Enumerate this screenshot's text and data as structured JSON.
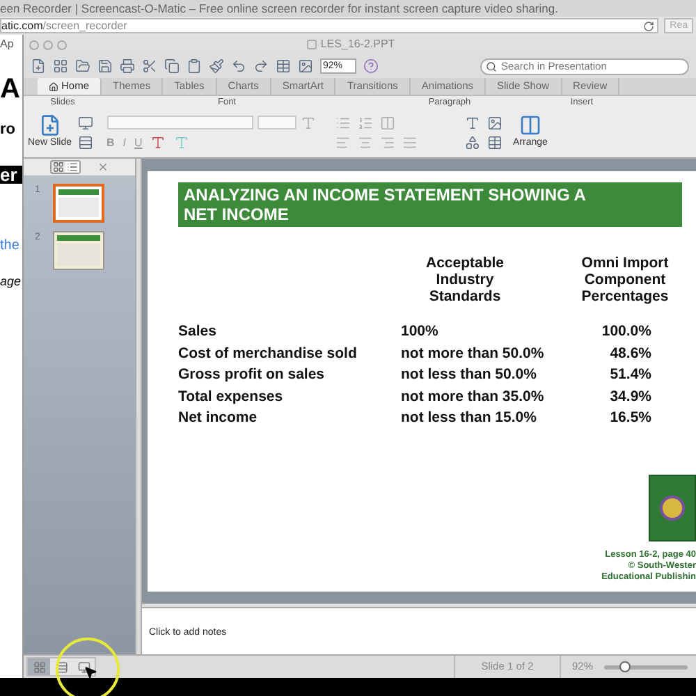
{
  "browser": {
    "title": "een Recorder | Screencast-O-Matic – Free online screen recorder for instant screen capture video sharing.",
    "url_host": "atic.com",
    "url_path": "/screen_recorder",
    "reader_button": "Rea"
  },
  "page_behind": [
    {
      "text": "Ap",
      "kind": "small"
    },
    {
      "text": "A",
      "kind": "big"
    },
    {
      "text": "ro",
      "kind": "bold"
    },
    {
      "text": "er",
      "kind": "dark"
    },
    {
      "text": "the",
      "kind": "link"
    },
    {
      "text": "age",
      "kind": "italic"
    }
  ],
  "window": {
    "title": "LES_16-2.PPT"
  },
  "toolbar": {
    "zoom": "92%",
    "search_placeholder": "Search in Presentation"
  },
  "tabs": [
    {
      "label": "Home",
      "selected": true
    },
    {
      "label": "Themes",
      "selected": false
    },
    {
      "label": "Tables",
      "selected": false
    },
    {
      "label": "Charts",
      "selected": false
    },
    {
      "label": "SmartArt",
      "selected": false
    },
    {
      "label": "Transitions",
      "selected": false
    },
    {
      "label": "Animations",
      "selected": false
    },
    {
      "label": "Slide Show",
      "selected": false
    },
    {
      "label": "Review",
      "selected": false
    }
  ],
  "ribbon": {
    "groups": [
      "Slides",
      "Font",
      "Paragraph",
      "Insert"
    ],
    "new_slide": "New Slide",
    "arrange": "Arrange",
    "font_buttons": [
      "B",
      "I",
      "U"
    ]
  },
  "slides": [
    {
      "number": "1",
      "selected": true
    },
    {
      "number": "2",
      "selected": false
    }
  ],
  "slide": {
    "title": "ANALYZING AN INCOME STATEMENT SHOWING A NET INCOME",
    "columns": [
      "Acceptable Industry Standards",
      "Omni Import Component Percentages"
    ],
    "rows": [
      {
        "label": "Sales",
        "standard": "100%",
        "percentage": "100.0%"
      },
      {
        "label": "Cost of merchandise sold",
        "standard": "not more than 50.0%",
        "percentage": "48.6%"
      },
      {
        "label": "Gross profit on sales",
        "standard": "not less than 50.0%",
        "percentage": "51.4%"
      },
      {
        "label": "Total expenses",
        "standard": "not more than 35.0%",
        "percentage": "34.9%"
      },
      {
        "label": "Net income",
        "standard": "not less than 15.0%",
        "percentage": "16.5%"
      }
    ],
    "caption": [
      "Lesson 16-2, page 40",
      "© South-Wester",
      "Educational Publishin"
    ]
  },
  "notes": {
    "placeholder": "Click to add notes"
  },
  "status_bar": {
    "views": [
      {
        "selected": true
      },
      {
        "selected": false
      },
      {
        "selected": false
      }
    ],
    "slide_counter": "Slide 1 of 2",
    "zoom": "92%",
    "zoom_slider": {
      "level": 0.25
    }
  }
}
